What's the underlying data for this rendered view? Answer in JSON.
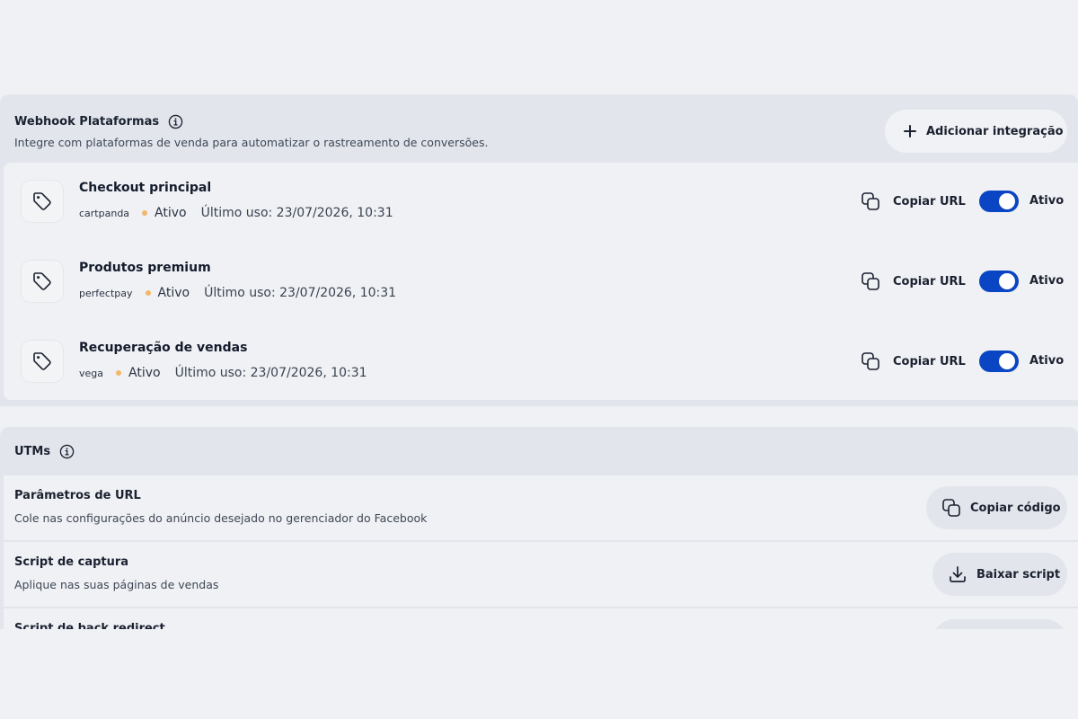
{
  "webhook": {
    "title": "Webhook Plataformas",
    "subtitle": "Integre com plataformas de venda para automatizar o rastreamento de conversões.",
    "add_button": "Adicionar integração",
    "copy_url_label": "Copiar URL",
    "toggle_label": "Ativo",
    "integrations": [
      {
        "name": "Checkout principal",
        "platform": "cartpanda",
        "status": "Ativo",
        "last_use": "Último uso: 23/07/2026, 10:31",
        "enabled": true
      },
      {
        "name": "Produtos premium",
        "platform": "perfectpay",
        "status": "Ativo",
        "last_use": "Último uso: 23/07/2026, 10:31",
        "enabled": true
      },
      {
        "name": "Recuperação de vendas",
        "platform": "vega",
        "status": "Ativo",
        "last_use": "Último uso: 23/07/2026, 10:31",
        "enabled": true
      }
    ]
  },
  "utms": {
    "title": "UTMs",
    "items": [
      {
        "title": "Parâmetros de URL",
        "subtitle": "Cole nas configurações do anúncio desejado no gerenciador do Facebook",
        "button": "Copiar código",
        "icon": "copy-icon"
      },
      {
        "title": "Script de captura",
        "subtitle": "Aplique nas suas páginas de vendas",
        "button": "Baixar script",
        "icon": "download-icon"
      },
      {
        "title": "Script de back redirect",
        "subtitle": "",
        "button": "",
        "icon": ""
      }
    ]
  },
  "colors": {
    "accent": "#0a45c4",
    "status_dot": "#f2b86a",
    "page_bg": "#eff1f4",
    "section_bg": "#e2e6ec"
  }
}
